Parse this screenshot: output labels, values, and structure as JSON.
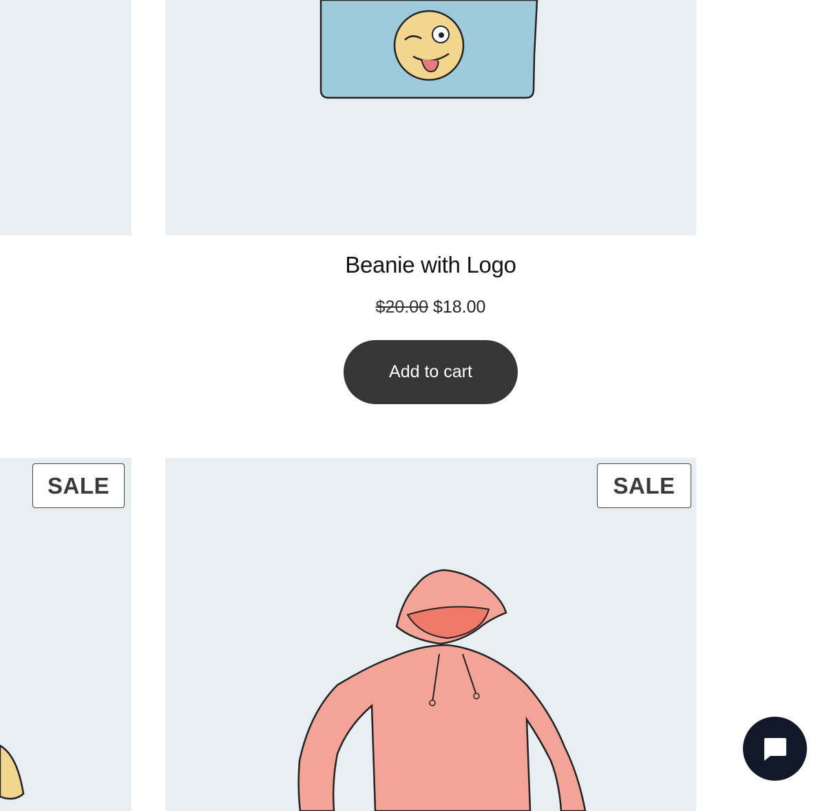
{
  "product": {
    "title": "Beanie with Logo",
    "price_old": "$20.00",
    "price_new": "$18.00",
    "add_to_cart": "Add to cart"
  },
  "badges": {
    "sale_left": "SALE",
    "sale_main": "SALE"
  },
  "icons": {
    "chat": "chat-bubble-icon"
  },
  "colors": {
    "tile_background": "#e9eef2",
    "button_background": "#363636",
    "chat_background": "#111827",
    "beanie": "#9ecbdc",
    "hoodie": "#f4a497"
  }
}
